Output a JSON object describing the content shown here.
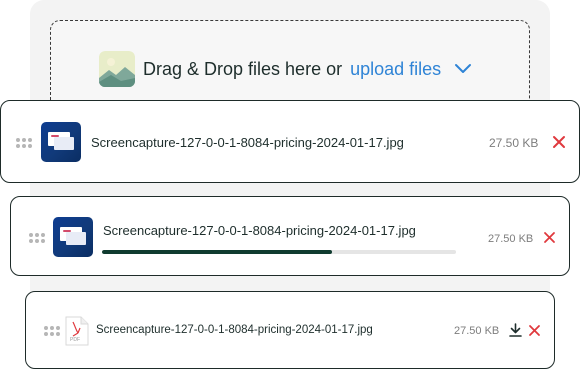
{
  "dropzone": {
    "prompt": "Drag & Drop files here or",
    "link": "upload files"
  },
  "files": [
    {
      "name": "Screencapture-127-0-0-1-8084-pricing-2024-01-17.jpg",
      "size": "27.50 KB",
      "type": "image"
    },
    {
      "name": "Screencapture-127-0-0-1-8084-pricing-2024-01-17.jpg",
      "size": "27.50 KB",
      "type": "image",
      "progress": 0.65
    },
    {
      "name": "Screencapture-127-0-0-1-8084-pricing-2024-01-17.jpg",
      "size": "27.50 KB",
      "type": "pdf",
      "badge": "PDF"
    }
  ],
  "icons": {
    "dropzone": "image-icon",
    "chevron": "chevron-down-icon",
    "handle": "drag-handle-icon",
    "remove": "close-icon",
    "download": "download-icon",
    "pdf": "pdf-file-icon"
  },
  "colors": {
    "accent": "#2f84d6",
    "danger": "#e0393e",
    "progress": "#0f3b2f",
    "border": "#1e2b29"
  }
}
